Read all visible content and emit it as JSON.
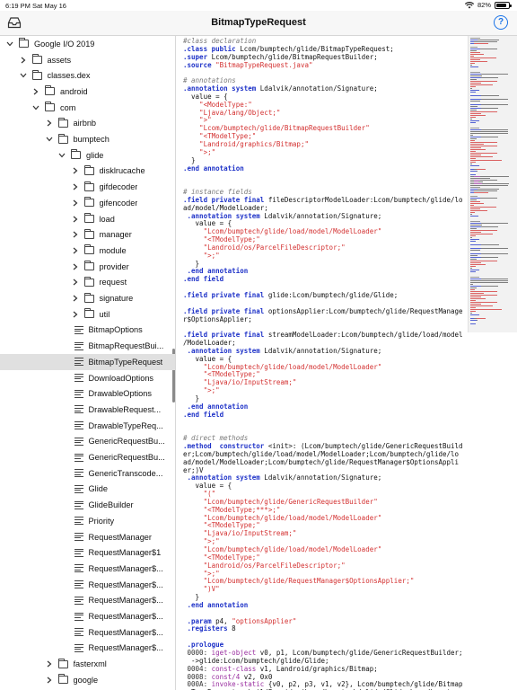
{
  "status_bar": {
    "time": "6:19 PM",
    "date": "Sat May 16",
    "battery": "82%",
    "battery_level": 0.82
  },
  "nav": {
    "title": "BitmapTypeRequest",
    "left_icon": "tray-icon",
    "right_icon": "help-icon",
    "help_glyph": "?"
  },
  "sidebar": {
    "items": [
      {
        "label": "Google I/O 2019",
        "depth": 0,
        "kind": "folder",
        "expanded": true
      },
      {
        "label": "assets",
        "depth": 1,
        "kind": "folder",
        "expanded": false
      },
      {
        "label": "classes.dex",
        "depth": 1,
        "kind": "folder",
        "expanded": true
      },
      {
        "label": "android",
        "depth": 2,
        "kind": "folder",
        "expanded": false
      },
      {
        "label": "com",
        "depth": 2,
        "kind": "folder",
        "expanded": true
      },
      {
        "label": "airbnb",
        "depth": 3,
        "kind": "folder",
        "expanded": false
      },
      {
        "label": "bumptech",
        "depth": 3,
        "kind": "folder",
        "expanded": true
      },
      {
        "label": "glide",
        "depth": 4,
        "kind": "folder",
        "expanded": true
      },
      {
        "label": "disklrucache",
        "depth": 5,
        "kind": "folder",
        "expanded": false
      },
      {
        "label": "gifdecoder",
        "depth": 5,
        "kind": "folder",
        "expanded": false
      },
      {
        "label": "gifencoder",
        "depth": 5,
        "kind": "folder",
        "expanded": false
      },
      {
        "label": "load",
        "depth": 5,
        "kind": "folder",
        "expanded": false
      },
      {
        "label": "manager",
        "depth": 5,
        "kind": "folder",
        "expanded": false
      },
      {
        "label": "module",
        "depth": 5,
        "kind": "folder",
        "expanded": false
      },
      {
        "label": "provider",
        "depth": 5,
        "kind": "folder",
        "expanded": false
      },
      {
        "label": "request",
        "depth": 5,
        "kind": "folder",
        "expanded": false
      },
      {
        "label": "signature",
        "depth": 5,
        "kind": "folder",
        "expanded": false
      },
      {
        "label": "util",
        "depth": 5,
        "kind": "folder",
        "expanded": false
      },
      {
        "label": "BitmapOptions",
        "depth": 5,
        "kind": "file"
      },
      {
        "label": "BitmapRequestBui...",
        "depth": 5,
        "kind": "file"
      },
      {
        "label": "BitmapTypeRequest",
        "depth": 5,
        "kind": "file",
        "selected": true
      },
      {
        "label": "DownloadOptions",
        "depth": 5,
        "kind": "file"
      },
      {
        "label": "DrawableOptions",
        "depth": 5,
        "kind": "file"
      },
      {
        "label": "DrawableRequest...",
        "depth": 5,
        "kind": "file"
      },
      {
        "label": "DrawableTypeReq...",
        "depth": 5,
        "kind": "file"
      },
      {
        "label": "GenericRequestBu...",
        "depth": 5,
        "kind": "file"
      },
      {
        "label": "GenericRequestBu...",
        "depth": 5,
        "kind": "file"
      },
      {
        "label": "GenericTranscode...",
        "depth": 5,
        "kind": "file"
      },
      {
        "label": "Glide",
        "depth": 5,
        "kind": "file"
      },
      {
        "label": "GlideBuilder",
        "depth": 5,
        "kind": "file"
      },
      {
        "label": "Priority",
        "depth": 5,
        "kind": "file"
      },
      {
        "label": "RequestManager",
        "depth": 5,
        "kind": "file"
      },
      {
        "label": "RequestManager$1",
        "depth": 5,
        "kind": "file"
      },
      {
        "label": "RequestManager$...",
        "depth": 5,
        "kind": "file"
      },
      {
        "label": "RequestManager$...",
        "depth": 5,
        "kind": "file"
      },
      {
        "label": "RequestManager$...",
        "depth": 5,
        "kind": "file"
      },
      {
        "label": "RequestManager$...",
        "depth": 5,
        "kind": "file"
      },
      {
        "label": "RequestManager$...",
        "depth": 5,
        "kind": "file"
      },
      {
        "label": "RequestManager$...",
        "depth": 5,
        "kind": "file"
      },
      {
        "label": "fasterxml",
        "depth": 3,
        "kind": "folder",
        "expanded": false
      },
      {
        "label": "google",
        "depth": 3,
        "kind": "folder",
        "expanded": false
      }
    ]
  },
  "colors": {
    "keyword": "#1e32c8",
    "string": "#d33030",
    "comment": "#7a7a7a",
    "opcode": "#9a2fa0",
    "selected_row": "#e0e0e0",
    "accent": "#1a73e8"
  },
  "code_lines": [
    [
      [
        "cm",
        "#class declaration"
      ]
    ],
    [
      [
        "kw",
        ".class public"
      ],
      [
        "tx",
        " Lcom/bumptech/glide/BitmapTypeRequest;"
      ]
    ],
    [
      [
        "kw",
        ".super"
      ],
      [
        "tx",
        " Lcom/bumptech/glide/BitmapRequestBuilder;"
      ]
    ],
    [
      [
        "kw",
        ".source"
      ],
      [
        "st",
        " \"BitmapTypeRequest.java\""
      ]
    ],
    [
      [
        "tx",
        ""
      ]
    ],
    [
      [
        "cm",
        "# annotations"
      ]
    ],
    [
      [
        "kw",
        ".annotation system"
      ],
      [
        "tx",
        " Ldalvik/annotation/Signature;"
      ]
    ],
    [
      [
        "tx",
        "  value = {"
      ]
    ],
    [
      [
        "st",
        "    \"<ModelType:\""
      ]
    ],
    [
      [
        "st",
        "    \"Ljava/lang/Object;\""
      ]
    ],
    [
      [
        "st",
        "    \">\""
      ]
    ],
    [
      [
        "st",
        "    \"Lcom/bumptech/glide/BitmapRequestBuilder\""
      ]
    ],
    [
      [
        "st",
        "    \"<TModelType;\""
      ]
    ],
    [
      [
        "st",
        "    \"Landroid/graphics/Bitmap;\""
      ]
    ],
    [
      [
        "st",
        "    \">;\""
      ]
    ],
    [
      [
        "tx",
        "  }"
      ]
    ],
    [
      [
        "kw",
        ".end annotation"
      ]
    ],
    [
      [
        "tx",
        ""
      ]
    ],
    [
      [
        "tx",
        ""
      ]
    ],
    [
      [
        "cm",
        "# instance fields"
      ]
    ],
    [
      [
        "kw",
        ".field private final"
      ],
      [
        "tx",
        " fileDescriptorModelLoader:Lcom/bumptech/glide/lo"
      ]
    ],
    [
      [
        "tx",
        "ad/model/ModelLoader;"
      ]
    ],
    [
      [
        "kw",
        " .annotation system"
      ],
      [
        "tx",
        " Ldalvik/annotation/Signature;"
      ]
    ],
    [
      [
        "tx",
        "   value = {"
      ]
    ],
    [
      [
        "st",
        "     \"Lcom/bumptech/glide/load/model/ModelLoader\""
      ]
    ],
    [
      [
        "st",
        "     \"<TModelType;\""
      ]
    ],
    [
      [
        "st",
        "     \"Landroid/os/ParcelFileDescriptor;\""
      ]
    ],
    [
      [
        "st",
        "     \">;\""
      ]
    ],
    [
      [
        "tx",
        "   }"
      ]
    ],
    [
      [
        "kw",
        " .end annotation"
      ]
    ],
    [
      [
        "kw",
        ".end field"
      ]
    ],
    [
      [
        "tx",
        ""
      ]
    ],
    [
      [
        "kw",
        ".field private final"
      ],
      [
        "tx",
        " glide:Lcom/bumptech/glide/Glide;"
      ]
    ],
    [
      [
        "tx",
        ""
      ]
    ],
    [
      [
        "kw",
        ".field private final"
      ],
      [
        "tx",
        " optionsApplier:Lcom/bumptech/glide/RequestManage"
      ]
    ],
    [
      [
        "tx",
        "r$OptionsApplier;"
      ]
    ],
    [
      [
        "tx",
        ""
      ]
    ],
    [
      [
        "kw",
        ".field private final"
      ],
      [
        "tx",
        " streamModelLoader:Lcom/bumptech/glide/load/model"
      ]
    ],
    [
      [
        "tx",
        "/ModelLoader;"
      ]
    ],
    [
      [
        "kw",
        " .annotation system"
      ],
      [
        "tx",
        " Ldalvik/annotation/Signature;"
      ]
    ],
    [
      [
        "tx",
        "   value = {"
      ]
    ],
    [
      [
        "st",
        "     \"Lcom/bumptech/glide/load/model/ModelLoader\""
      ]
    ],
    [
      [
        "st",
        "     \"<TModelType;\""
      ]
    ],
    [
      [
        "st",
        "     \"Ljava/io/InputStream;\""
      ]
    ],
    [
      [
        "st",
        "     \">;\""
      ]
    ],
    [
      [
        "tx",
        "   }"
      ]
    ],
    [
      [
        "kw",
        " .end annotation"
      ]
    ],
    [
      [
        "kw",
        ".end field"
      ]
    ],
    [
      [
        "tx",
        ""
      ]
    ],
    [
      [
        "tx",
        ""
      ]
    ],
    [
      [
        "cm",
        "# direct methods"
      ]
    ],
    [
      [
        "kw",
        ".method  constructor"
      ],
      [
        "tx",
        " <init>: (Lcom/bumptech/glide/GenericRequestBuild"
      ]
    ],
    [
      [
        "tx",
        "er;Lcom/bumptech/glide/load/model/ModelLoader;Lcom/bumptech/glide/lo"
      ]
    ],
    [
      [
        "tx",
        "ad/model/ModelLoader;Lcom/bumptech/glide/RequestManager$OptionsAppli"
      ]
    ],
    [
      [
        "tx",
        "er;)V"
      ]
    ],
    [
      [
        "kw",
        " .annotation system"
      ],
      [
        "tx",
        " Ldalvik/annotation/Signature;"
      ]
    ],
    [
      [
        "tx",
        "   value = {"
      ]
    ],
    [
      [
        "st",
        "     \"(\""
      ]
    ],
    [
      [
        "st",
        "     \"Lcom/bumptech/glide/GenericRequestBuilder\""
      ]
    ],
    [
      [
        "st",
        "     \"<TModelType;***>;\""
      ]
    ],
    [
      [
        "st",
        "     \"Lcom/bumptech/glide/load/model/ModelLoader\""
      ]
    ],
    [
      [
        "st",
        "     \"<TModelType;\""
      ]
    ],
    [
      [
        "st",
        "     \"Ljava/io/InputStream;\""
      ]
    ],
    [
      [
        "st",
        "     \">;\""
      ]
    ],
    [
      [
        "st",
        "     \"Lcom/bumptech/glide/load/model/ModelLoader\""
      ]
    ],
    [
      [
        "st",
        "     \"<TModelType;\""
      ]
    ],
    [
      [
        "st",
        "     \"Landroid/os/ParcelFileDescriptor;\""
      ]
    ],
    [
      [
        "st",
        "     \">;\""
      ]
    ],
    [
      [
        "st",
        "     \"Lcom/bumptech/glide/RequestManager$OptionsApplier;\""
      ]
    ],
    [
      [
        "st",
        "     \")V\""
      ]
    ],
    [
      [
        "tx",
        "   }"
      ]
    ],
    [
      [
        "kw",
        " .end annotation"
      ]
    ],
    [
      [
        "tx",
        ""
      ]
    ],
    [
      [
        "kw",
        " .param"
      ],
      [
        "tx",
        " p4, "
      ],
      [
        "st",
        "\"optionsApplier\""
      ]
    ],
    [
      [
        "kw",
        " .registers"
      ],
      [
        "tx",
        " 8"
      ]
    ],
    [
      [
        "tx",
        ""
      ]
    ],
    [
      [
        "kw",
        " .prologue"
      ]
    ],
    [
      [
        "nm",
        " 0000:"
      ],
      [
        "op",
        " iget-object"
      ],
      [
        "tx",
        " v0, p1, Lcom/bumptech/glide/GenericRequestBuilder;"
      ]
    ],
    [
      [
        "tx",
        "  ->glide:Lcom/bumptech/glide/Glide;"
      ]
    ],
    [
      [
        "nm",
        " 0004:"
      ],
      [
        "op",
        " const-class"
      ],
      [
        "tx",
        " v1, Landroid/graphics/Bitmap;"
      ]
    ],
    [
      [
        "nm",
        " 0008:"
      ],
      [
        "op",
        " const/4"
      ],
      [
        "tx",
        " v2, 0x0"
      ]
    ],
    [
      [
        "nm",
        " 000A:"
      ],
      [
        "op",
        " invoke-static"
      ],
      [
        "tx",
        " {v0, p2, p3, v1, v2}, Lcom/bumptech/glide/Bitmap"
      ]
    ],
    [
      [
        "tx",
        "  TypeRequest;->buildProvider(Lcom/bumptech/glide/Glide;Lcom/bumptec"
      ]
    ]
  ]
}
